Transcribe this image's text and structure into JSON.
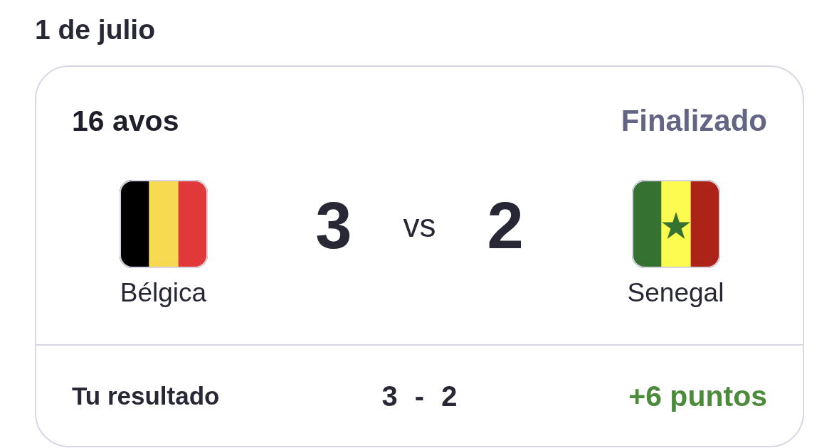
{
  "date": "1 de julio",
  "match": {
    "round": "16 avos",
    "status": "Finalizado",
    "separator": "vs",
    "teams": [
      {
        "name": "Bélgica",
        "kind": "belgium",
        "score": "3"
      },
      {
        "name": "Senegal",
        "kind": "senegal",
        "score": "2"
      }
    ]
  },
  "prediction": {
    "label": "Tu resultado",
    "scores": [
      "3",
      "2"
    ],
    "separator": "-",
    "points": "+6 puntos"
  }
}
